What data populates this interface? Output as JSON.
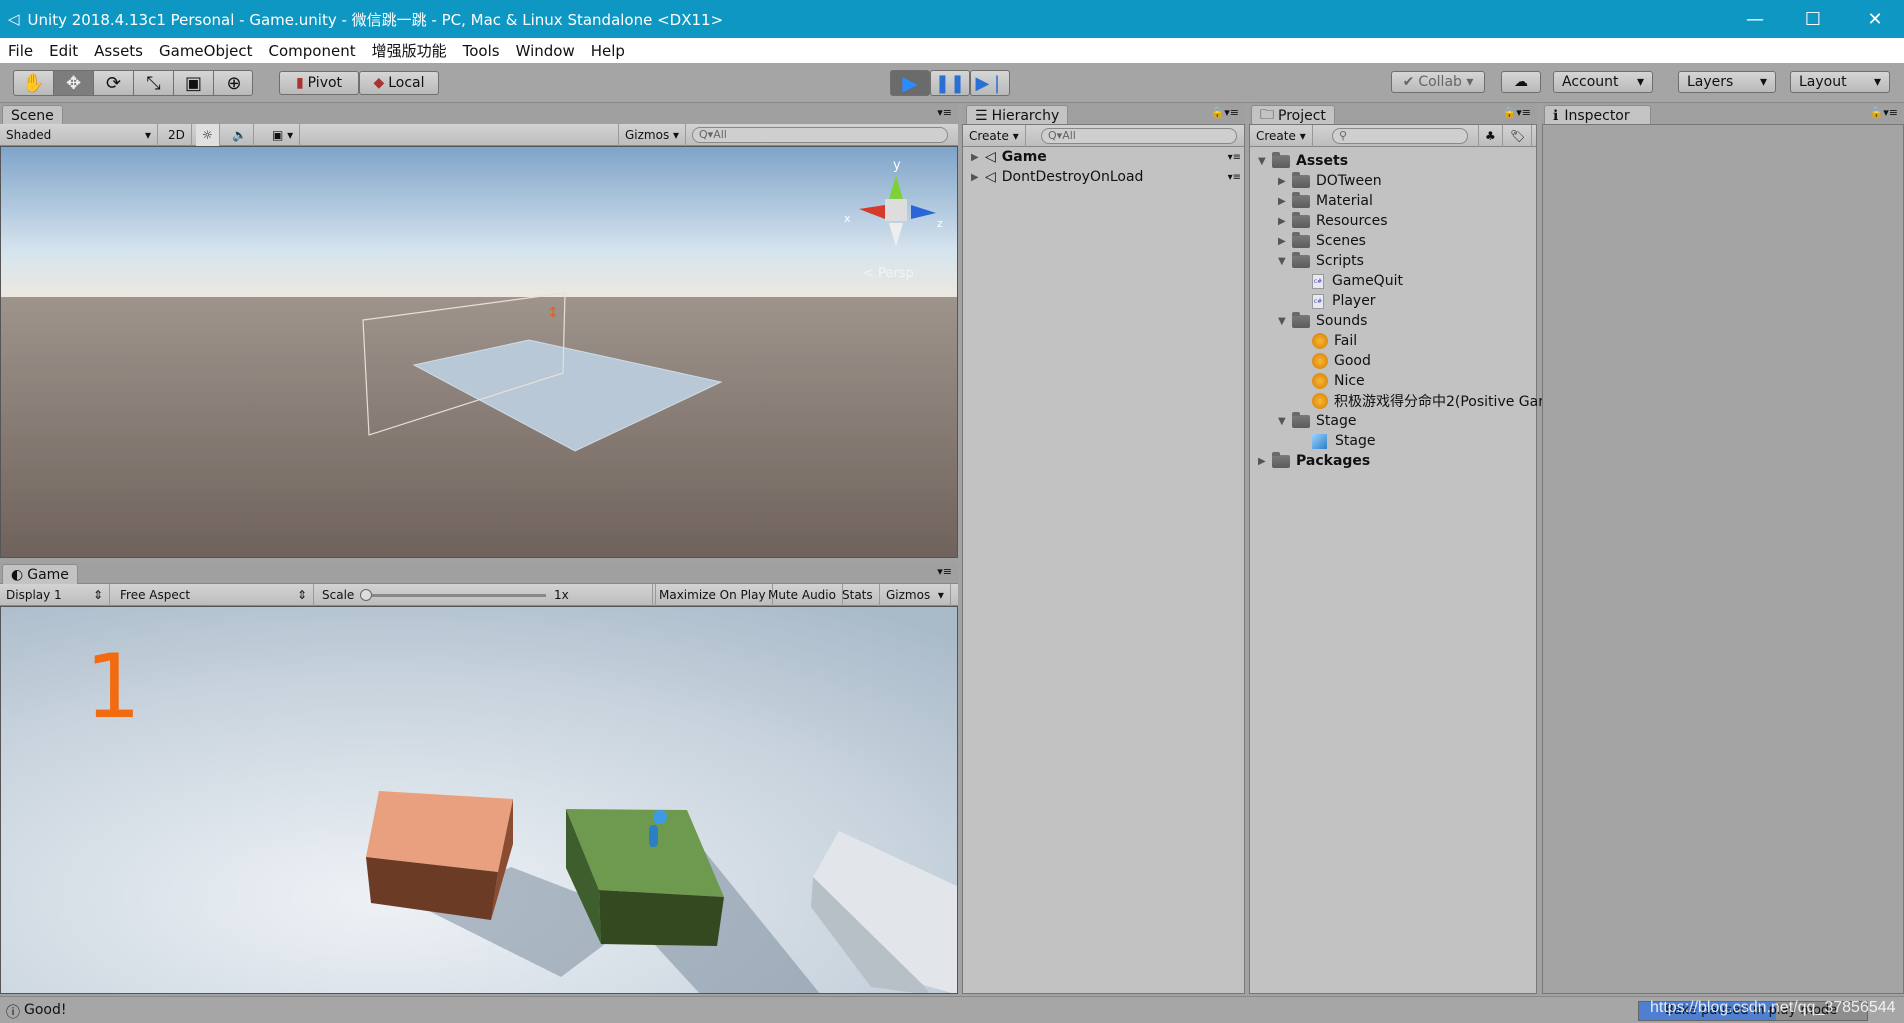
{
  "window": {
    "title": "Unity 2018.4.13c1 Personal - Game.unity - 微信跳一跳 - PC, Mac & Linux Standalone <DX11>",
    "minimize": "—",
    "maximize": "☐",
    "close": "✕"
  },
  "menu": [
    "File",
    "Edit",
    "Assets",
    "GameObject",
    "Component",
    "增强版功能",
    "Tools",
    "Window",
    "Help"
  ],
  "toolbar": {
    "tools": [
      "hand-tool",
      "move-tool",
      "rotate-tool",
      "scale-tool",
      "rect-tool",
      "transform-tool"
    ],
    "pivot": "Pivot",
    "local": "Local",
    "collab": "Collab",
    "account": "Account",
    "layers": "Layers",
    "layout": "Layout",
    "play_color": "#2a8cff"
  },
  "scene": {
    "tab": "Scene",
    "shading": "Shaded",
    "mode_2d": "2D",
    "gizmos": "Gizmos",
    "search_placeholder": "All",
    "persp": "Persp",
    "axis_y": "y",
    "axis_x": "x",
    "axis_z": "z"
  },
  "game": {
    "tab": "Game",
    "display": "Display 1",
    "aspect": "Free Aspect",
    "scale_label": "Scale",
    "scale_value": "1x",
    "maximize": "Maximize On Play",
    "mute": "Mute Audio",
    "stats": "Stats",
    "gizmos": "Gizmos",
    "score": "1",
    "score_color": "#f26b10"
  },
  "hierarchy": {
    "tab": "Hierarchy",
    "create": "Create",
    "search_placeholder": "All",
    "items": [
      "Game",
      "DontDestroyOnLoad"
    ]
  },
  "project": {
    "tab": "Project",
    "create": "Create",
    "tree": [
      {
        "label": "Assets",
        "level": 0,
        "type": "folder",
        "open": true,
        "bold": true
      },
      {
        "label": "DOTween",
        "level": 1,
        "type": "folder",
        "open": false
      },
      {
        "label": "Material",
        "level": 1,
        "type": "folder",
        "open": false
      },
      {
        "label": "Resources",
        "level": 1,
        "type": "folder",
        "open": false
      },
      {
        "label": "Scenes",
        "level": 1,
        "type": "folder",
        "open": false
      },
      {
        "label": "Scripts",
        "level": 1,
        "type": "folder",
        "open": true
      },
      {
        "label": "GameQuit",
        "level": 2,
        "type": "script"
      },
      {
        "label": "Player",
        "level": 2,
        "type": "script"
      },
      {
        "label": "Sounds",
        "level": 1,
        "type": "folder",
        "open": true
      },
      {
        "label": "Fail",
        "level": 2,
        "type": "audio"
      },
      {
        "label": "Good",
        "level": 2,
        "type": "audio"
      },
      {
        "label": "Nice",
        "level": 2,
        "type": "audio"
      },
      {
        "label": "积极游戏得分命中2(Positive Gar",
        "level": 2,
        "type": "audio"
      },
      {
        "label": "Stage",
        "level": 1,
        "type": "folder",
        "open": true
      },
      {
        "label": "Stage",
        "level": 2,
        "type": "prefab"
      },
      {
        "label": "Packages",
        "level": 0,
        "type": "folder",
        "open": false,
        "bold": true
      }
    ]
  },
  "inspector": {
    "tab": "Inspector"
  },
  "status": {
    "message": "Good!",
    "progress_label": "Bake paused in play mode",
    "progress_percent": 60,
    "watermark": "https://blog.csdn.net/qq_37856544"
  }
}
